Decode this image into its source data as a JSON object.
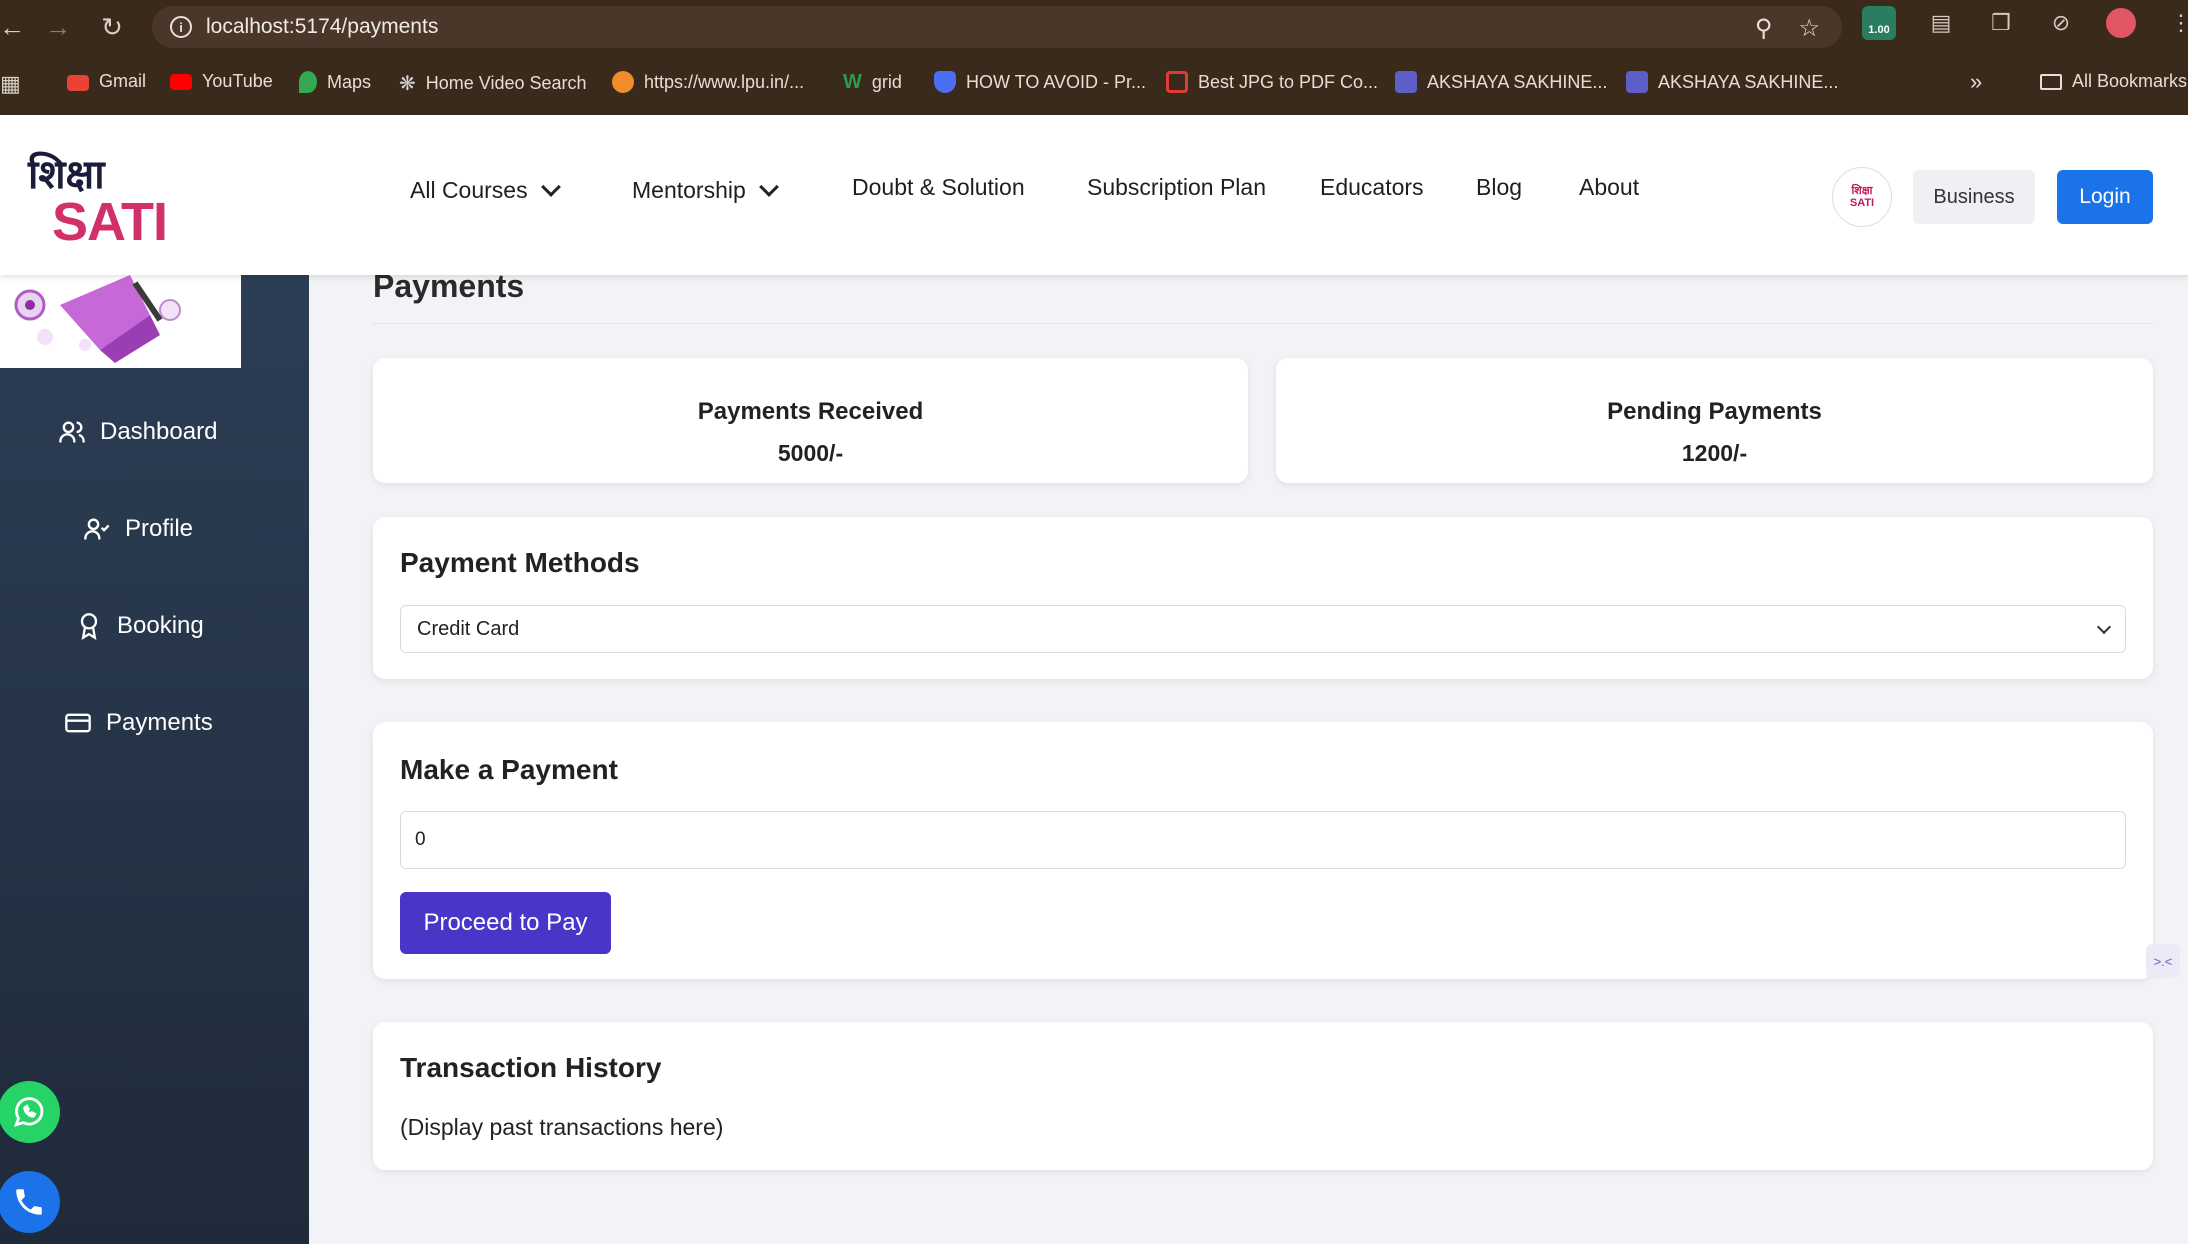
{
  "browser": {
    "url": "localhost:5174/payments",
    "extension_badge": "1.00",
    "bookmarks": [
      {
        "label": "Gmail",
        "icon": "gmail-icon",
        "color": "#ea4335"
      },
      {
        "label": "YouTube",
        "icon": "youtube-icon",
        "color": "#ff0000"
      },
      {
        "label": "Maps",
        "icon": "maps-icon",
        "color": "#34a853"
      },
      {
        "label": "Home Video Search",
        "icon": "dots-icon",
        "color": "#cfcfcf"
      },
      {
        "label": "https://www.lpu.in/...",
        "icon": "lpu-icon",
        "color": "#f08c2a"
      },
      {
        "label": "grid",
        "icon": "grid-icon",
        "color": "#2e9b4a"
      },
      {
        "label": "HOW TO AVOID - Pr...",
        "icon": "shield-icon",
        "color": "#4b6ef5"
      },
      {
        "label": "Best JPG to PDF Co...",
        "icon": "pdf-icon",
        "color": "#e53935"
      },
      {
        "label": "AKSHAYA SAKHINE...",
        "icon": "teams-icon",
        "color": "#5b5fc7"
      },
      {
        "label": "AKSHAYA SAKHINE...",
        "icon": "teams-icon",
        "color": "#5b5fc7"
      }
    ],
    "all_bookmarks": "All Bookmarks"
  },
  "header": {
    "logo_top": "शिक्षा",
    "logo_bottom": "SATI",
    "avatar_text": "शिक्षा SATI",
    "menu": [
      {
        "label": "All Courses",
        "dropdown": true
      },
      {
        "label": "Mentorship",
        "dropdown": true
      },
      {
        "label": "Doubt & Solution",
        "dropdown": false
      },
      {
        "label": "Subscription Plan",
        "dropdown": false
      },
      {
        "label": "Educators",
        "dropdown": false
      },
      {
        "label": "Blog",
        "dropdown": false
      },
      {
        "label": "About",
        "dropdown": false
      }
    ],
    "business_label": "Business",
    "login_label": "Login"
  },
  "sidebar": {
    "items": [
      {
        "label": "Dashboard",
        "icon": "users-icon"
      },
      {
        "label": "Profile",
        "icon": "user-check-icon"
      },
      {
        "label": "Booking",
        "icon": "award-icon"
      },
      {
        "label": "Payments",
        "icon": "credit-card-icon"
      }
    ]
  },
  "main": {
    "title": "Payments",
    "stats": [
      {
        "title": "Payments Received",
        "value": "5000/-"
      },
      {
        "title": "Pending Payments",
        "value": "1200/-"
      }
    ],
    "payment_methods": {
      "title": "Payment Methods",
      "selected": "Credit Card"
    },
    "make_payment": {
      "title": "Make a Payment",
      "amount_value": "0",
      "button_label": "Proceed to Pay"
    },
    "transactions": {
      "title": "Transaction History",
      "placeholder_text": "(Display past transactions here)"
    }
  },
  "colors": {
    "browser_bg": "#3a2a1c",
    "sidebar_bg": "#2c3e55",
    "accent_blue": "#1a73e8",
    "pay_button": "#4a35c9",
    "whatsapp": "#25d366",
    "phone": "#1a73e8"
  }
}
